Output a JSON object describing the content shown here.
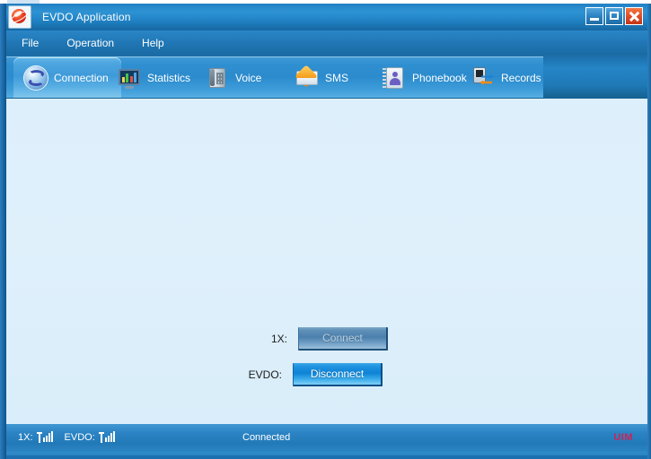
{
  "window": {
    "title": "EVDO Application",
    "app_icon": "comet-planet-icon",
    "controls": {
      "minimize": "minimize-icon",
      "maximize": "maximize-icon",
      "close": "close-icon"
    }
  },
  "menubar": {
    "items": [
      {
        "label": "File"
      },
      {
        "label": "Operation"
      },
      {
        "label": "Help"
      }
    ]
  },
  "toolbar": {
    "items": [
      {
        "label": "Connection",
        "icon": "sync-circle-icon",
        "selected": true
      },
      {
        "label": "Statistics",
        "icon": "monitor-chart-icon",
        "selected": false
      },
      {
        "label": "Voice",
        "icon": "desk-phone-icon",
        "selected": false
      },
      {
        "label": "SMS",
        "icon": "envelope-icon",
        "selected": false
      },
      {
        "label": "Phonebook",
        "icon": "address-book-icon",
        "selected": false
      },
      {
        "label": "Records",
        "icon": "device-transfer-icon",
        "selected": false
      }
    ]
  },
  "main": {
    "rows": [
      {
        "label": "1X:",
        "button_label": "Connect",
        "enabled": false
      },
      {
        "label": "EVDO:",
        "button_label": "Disconnect",
        "enabled": true
      }
    ]
  },
  "statusbar": {
    "signal_1x_label": "1X:",
    "signal_1x_icon": "signal-bars-icon",
    "signal_evdo_label": "EVDO:",
    "signal_evdo_icon": "signal-bars-icon",
    "status_text": "Connected",
    "uim_text": "UIM",
    "uim_color": "#cf2255"
  }
}
